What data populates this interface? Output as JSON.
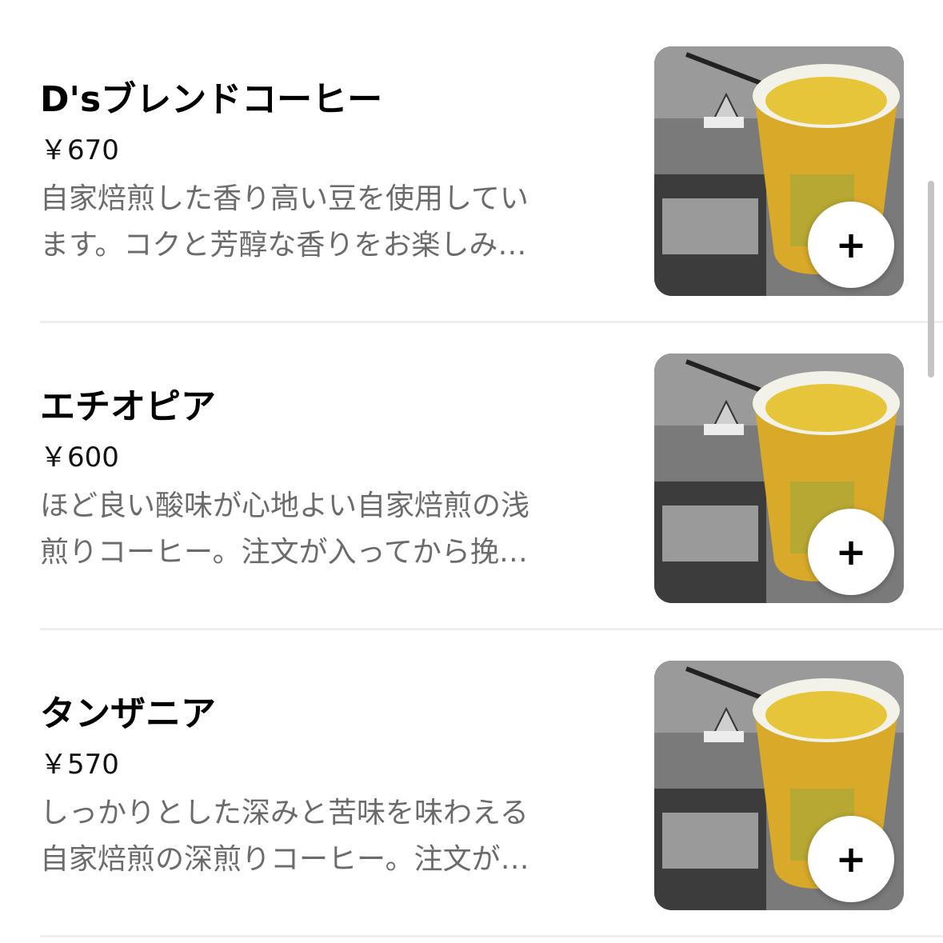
{
  "menu": {
    "items": [
      {
        "name": "D'sブレンドコーヒー",
        "price": "￥670",
        "description_lines": [
          "自家焙煎した香り高い豆を使用してい",
          "ます。コクと芳醇な香りをお楽しみ…"
        ],
        "add_label": "+",
        "image_icon": "coffee-cup-photo"
      },
      {
        "name": "エチオピア",
        "price": "￥600",
        "description_lines": [
          "ほど良い酸味が心地よい自家焙煎の浅",
          "煎りコーヒー。注文が入ってから挽…"
        ],
        "add_label": "+",
        "image_icon": "coffee-cup-photo"
      },
      {
        "name": "タンザニア",
        "price": "￥570",
        "description_lines": [
          "しっかりとした深みと苦味を味わえる",
          "自家焙煎の深煎りコーヒー。注文が…"
        ],
        "add_label": "+",
        "image_icon": "coffee-cup-photo"
      }
    ]
  },
  "colors": {
    "background": "#ffffff",
    "title": "#000000",
    "description": "#6b6b6b",
    "cup": "#d9a92a",
    "coffee": "#e6c53a"
  }
}
